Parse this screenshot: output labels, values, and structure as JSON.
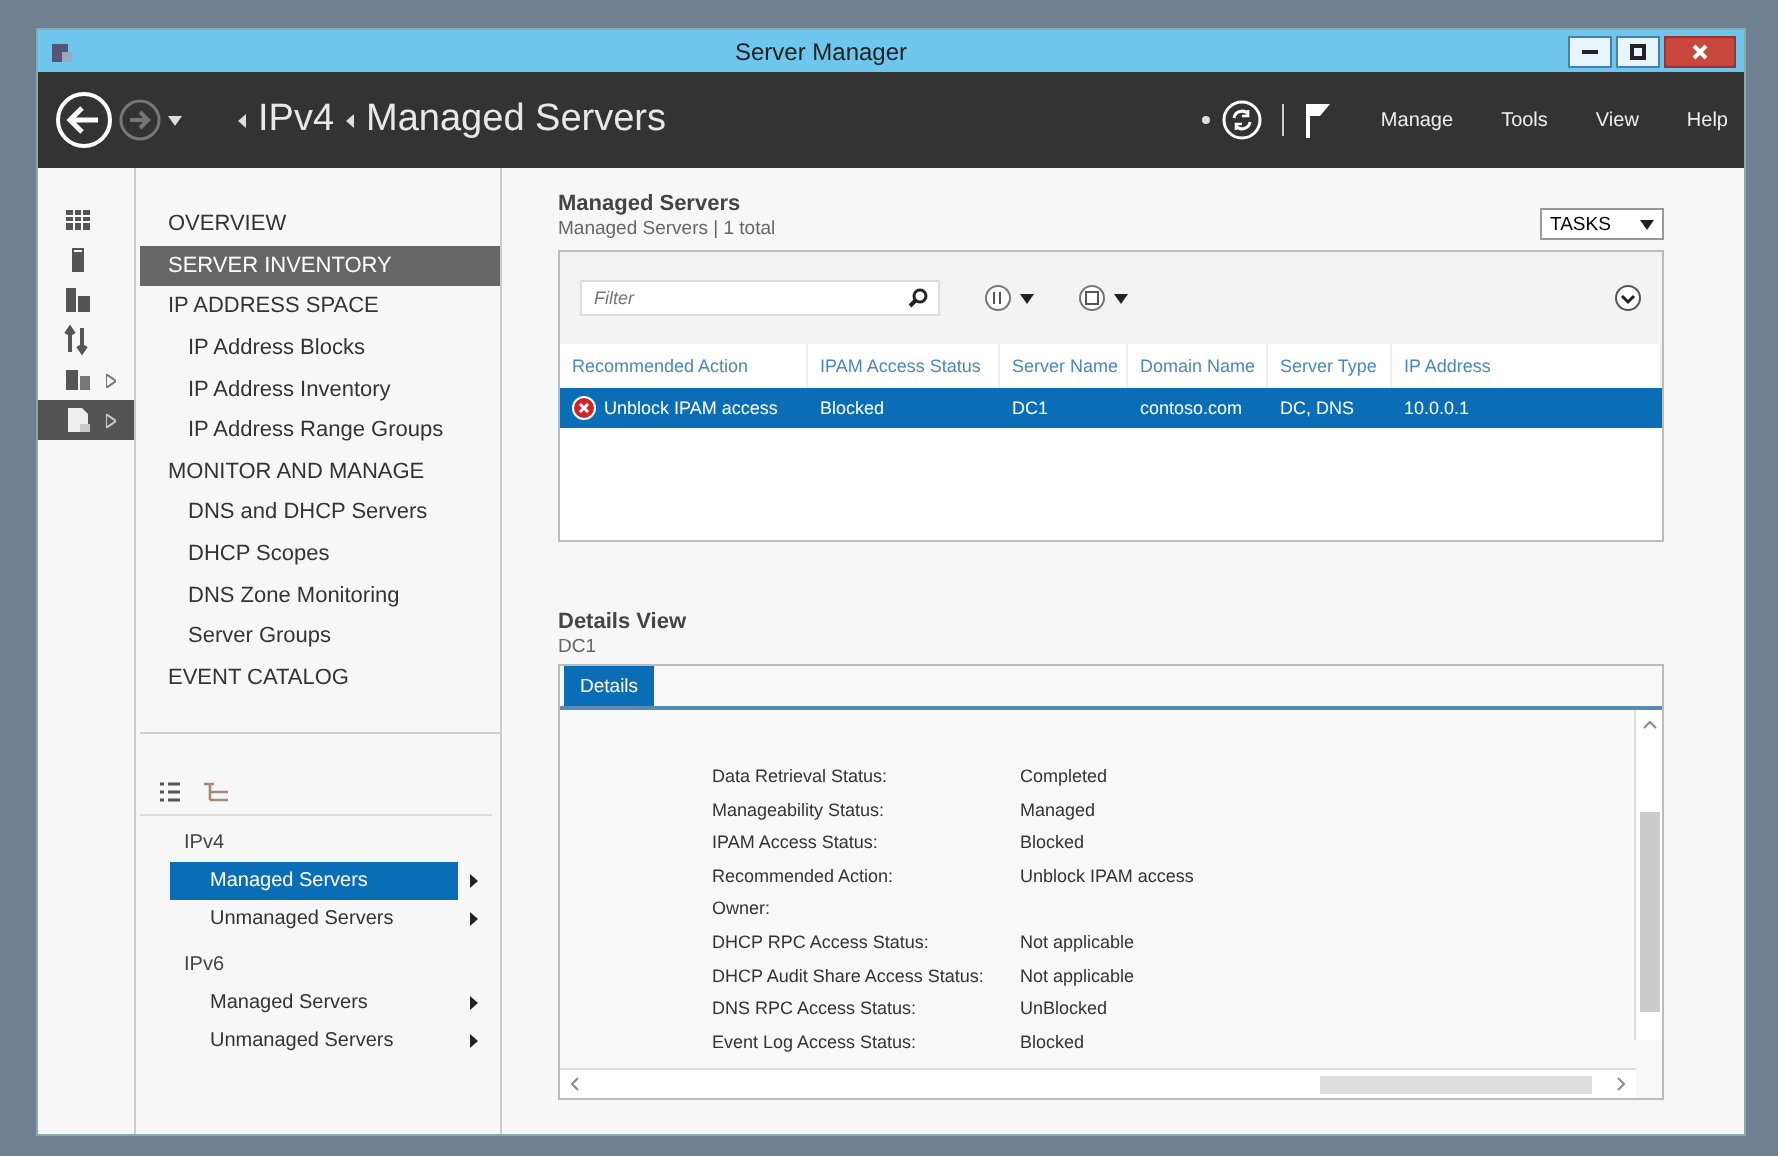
{
  "window": {
    "title": "Server Manager"
  },
  "header": {
    "breadcrumb": [
      "IPv4",
      "Managed Servers"
    ],
    "menu": [
      "Manage",
      "Tools",
      "View",
      "Help"
    ]
  },
  "rail": [
    {
      "kind": "dashboard",
      "expandable": false,
      "selected": false
    },
    {
      "kind": "server",
      "expandable": false,
      "selected": false
    },
    {
      "kind": "servers",
      "expandable": false,
      "selected": false
    },
    {
      "kind": "tools",
      "expandable": false,
      "selected": false
    },
    {
      "kind": "roles",
      "expandable": true,
      "selected": false
    },
    {
      "kind": "ipam",
      "expandable": true,
      "selected": true
    }
  ],
  "nav": [
    {
      "kind": "section",
      "label": "OVERVIEW",
      "selected": false
    },
    {
      "kind": "section",
      "label": "SERVER INVENTORY",
      "selected": true
    },
    {
      "kind": "section",
      "label": "IP ADDRESS SPACE",
      "selected": false
    },
    {
      "kind": "item",
      "label": "IP Address Blocks",
      "selected": false
    },
    {
      "kind": "item",
      "label": "IP Address Inventory",
      "selected": false
    },
    {
      "kind": "item",
      "label": "IP Address Range Groups",
      "selected": false
    },
    {
      "kind": "section",
      "label": "MONITOR AND MANAGE",
      "selected": false
    },
    {
      "kind": "item",
      "label": "DNS and DHCP Servers",
      "selected": false
    },
    {
      "kind": "item",
      "label": "DHCP Scopes",
      "selected": false
    },
    {
      "kind": "item",
      "label": "DNS Zone Monitoring",
      "selected": false
    },
    {
      "kind": "item",
      "label": "Server Groups",
      "selected": false
    },
    {
      "kind": "section",
      "label": "EVENT CATALOG",
      "selected": false
    }
  ],
  "tree": [
    {
      "label": "IPv4",
      "children": [
        {
          "label": "Managed Servers",
          "selected": true
        },
        {
          "label": "Unmanaged Servers",
          "selected": false
        }
      ]
    },
    {
      "label": "IPv6",
      "children": [
        {
          "label": "Managed Servers",
          "selected": false
        },
        {
          "label": "Unmanaged Servers",
          "selected": false
        }
      ]
    }
  ],
  "list": {
    "title": "Managed Servers",
    "subtitle": "Managed Servers | 1 total",
    "tasks": "TASKS",
    "filter": {
      "placeholder": "Filter"
    },
    "columns": [
      "Recommended Action",
      "IPAM Access Status",
      "Server Name",
      "Domain Name",
      "Server Type",
      "IP Address"
    ],
    "rows": [
      {
        "kind": "error",
        "selected": true,
        "cells": [
          "Unblock IPAM access",
          "Blocked",
          "DC1",
          "contoso.com",
          "DC, DNS",
          "10.0.0.1"
        ]
      }
    ]
  },
  "details": {
    "title": "Details View",
    "subtitle": "DC1",
    "tabs": [
      {
        "label": "Details",
        "selected": true
      }
    ],
    "fields": [
      {
        "label": "Data Retrieval Status:",
        "value": "Completed"
      },
      {
        "label": "Manageability Status:",
        "value": "Managed"
      },
      {
        "label": "IPAM Access Status:",
        "value": "Blocked"
      },
      {
        "label": "Recommended Action:",
        "value": "Unblock IPAM access"
      },
      {
        "label": "Owner:"
      },
      {
        "label": "DHCP RPC Access Status:",
        "value": "Not applicable"
      },
      {
        "label": "DHCP Audit Share Access Status:",
        "value": "Not applicable"
      },
      {
        "label": "DNS RPC Access Status:",
        "value": "UnBlocked"
      },
      {
        "label": "Event Log Access Status:",
        "value": "Blocked"
      }
    ]
  }
}
